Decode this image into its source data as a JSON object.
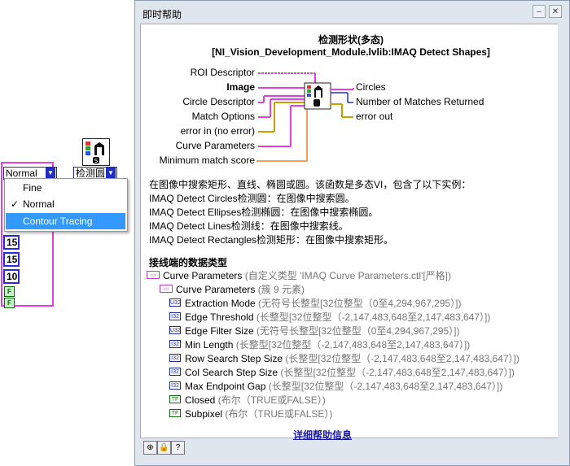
{
  "diagram": {
    "enum_value": "Normal",
    "method_label": "检测圆",
    "numbers": [
      "15",
      "15",
      "10"
    ],
    "bool_glyph": "F",
    "menu": {
      "items": [
        {
          "label": "Fine",
          "checked": false,
          "selected": false
        },
        {
          "label": "Normal",
          "checked": true,
          "selected": false
        },
        {
          "label": "Contour Tracing",
          "checked": false,
          "selected": true
        }
      ],
      "check_glyph": "✓"
    }
  },
  "help": {
    "window_title": "即时帮助",
    "heading_line1": "检测形状(多态)",
    "heading_line2": "[NI_Vision_Development_Module.lvlib:IMAQ Detect Shapes]",
    "inputs": {
      "roi": "ROI Descriptor",
      "image": "Image",
      "circle": "Circle Descriptor",
      "match": "Match Options",
      "error_in": "error in (no error)",
      "curve": "Curve Parameters",
      "min_score": "Minimum match score"
    },
    "outputs": {
      "circles": "Circles",
      "num_matches": "Number of Matches Returned",
      "error_out": "error out"
    },
    "description": [
      "在图像中搜索矩形、直线、椭圆或圆。该函数是多态VI，包含了以下实例：",
      "IMAQ Detect Circles检测圆：在图像中搜索圆。",
      "IMAQ Detect Ellipses检测椭圆：在图像中搜索椭圆。",
      "IMAQ Detect Lines检测线：在图像中搜索线。",
      "IMAQ Detect Rectangles检测矩形：在图像中搜索矩形。"
    ],
    "section_title": "接线端的数据类型",
    "tree": [
      {
        "indent": 0,
        "icon": "cluster",
        "name": "Curve Parameters",
        "type": " (自定义类型 'IMAQ Curve Parameters.ctl'[严格])"
      },
      {
        "indent": 1,
        "icon": "cluster",
        "name": "Curve Parameters",
        "type": " (簇 9 元素)"
      },
      {
        "indent": 2,
        "icon": "u32",
        "name": "Extraction Mode",
        "type": " (无符号长整型[32位整型（0至4,294,967,295）])"
      },
      {
        "indent": 2,
        "icon": "i32",
        "name": "Edge Threshold",
        "type": " (长整型[32位整型（-2,147,483,648至2,147,483,647）])"
      },
      {
        "indent": 2,
        "icon": "u32",
        "name": "Edge Filter Size",
        "type": " (无符号长整型[32位整型（0至4,294,967,295）])"
      },
      {
        "indent": 2,
        "icon": "i32",
        "name": "Min Length",
        "type": " (长整型[32位整型（-2,147,483,648至2,147,483,647）])"
      },
      {
        "indent": 2,
        "icon": "i32",
        "name": "Row Search Step Size",
        "type": " (长整型[32位整型（-2,147,483,648至2,147,483,647）])"
      },
      {
        "indent": 2,
        "icon": "i32",
        "name": "Col Search Step Size",
        "type": " (长整型[32位整型（-2,147,483,648至2,147,483,647）])"
      },
      {
        "indent": 2,
        "icon": "i32",
        "name": "Max Endpoint Gap",
        "type": " (长整型[32位整型（-2,147,483,648至2,147,483,647）])"
      },
      {
        "indent": 2,
        "icon": "tf",
        "name": "Closed",
        "type": " (布尔（TRUE或FALSE）)"
      },
      {
        "indent": 2,
        "icon": "tf",
        "name": "Subpixel",
        "type": " (布尔（TRUE或FALSE）)"
      }
    ],
    "icon_glyphs": {
      "cluster": "▭",
      "u32": "U32",
      "i32": "I32",
      "tf": "TF"
    },
    "detail_link": "详细帮助信息",
    "colors": {
      "wire_pink": "#e040e0",
      "wire_blue": "#2030c0",
      "wire_yellow": "#c8a000",
      "wire_orange": "#f08020",
      "link": "#1a1aa8"
    }
  }
}
